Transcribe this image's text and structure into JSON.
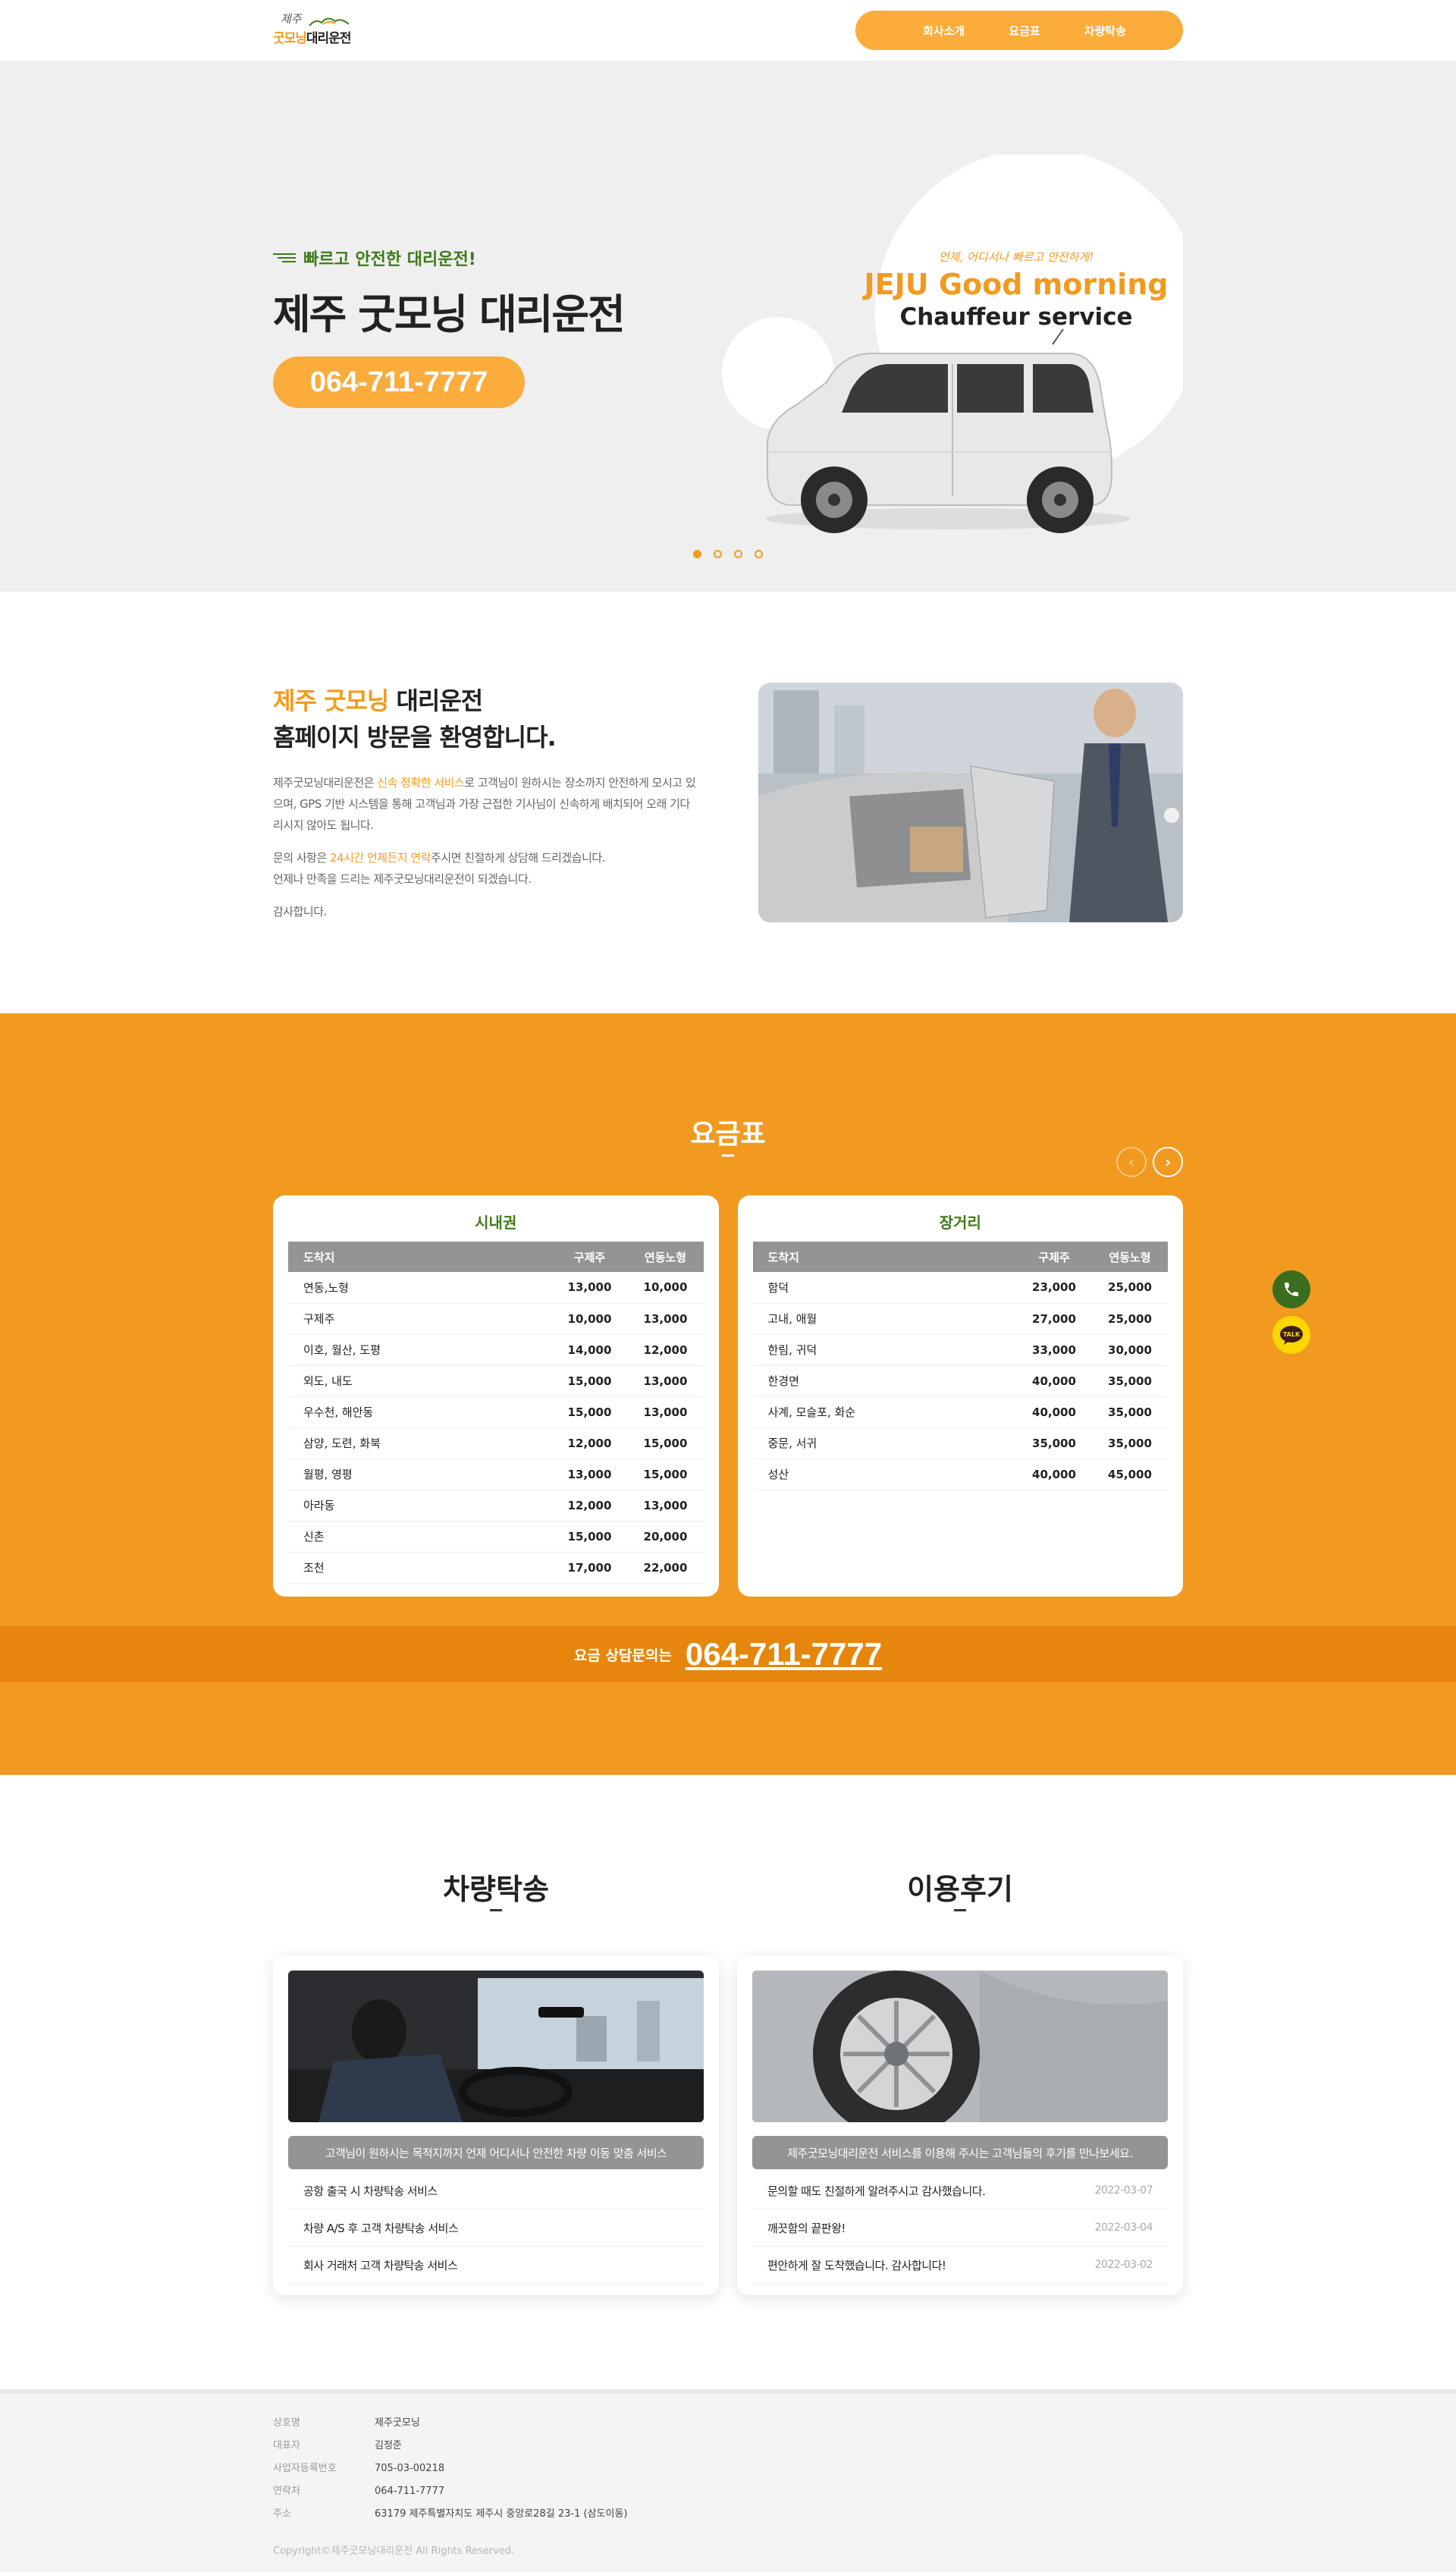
{
  "header": {
    "logo_top": "제주",
    "logo_main_orange": "굿모닝",
    "logo_main_dark": "대리운전",
    "nav": [
      "회사소개",
      "요금표",
      "차량탁송"
    ]
  },
  "hero": {
    "subtitle": "빠르고 안전한 대리운전!",
    "title": "제주 굿모닝 대리운전",
    "phone": "064-711-7777",
    "art_script": "언제, 어디서나 빠르고 안전하게!",
    "art_title": "JEJU Good morning",
    "art_sub": "Chauffeur service",
    "slides": 4
  },
  "welcome": {
    "title_orange": "제주 굿모닝",
    "title_rest": " 대리운전",
    "title_line2": "홈페이지 방문을 환영합니다.",
    "p1_a": "제주굿모닝대리운전은 ",
    "p1_hl": "신속 정확한 서비스",
    "p1_b": "로 고객님이 원하시는 장소까지 안전하게 모시고 있으며, GPS 기반 시스템을 통해 고객님과 가장 근접한 기사님이 신속하게 배치되어 오래 기다리시지 않아도 됩니다.",
    "p2_a": "문의 사항은 ",
    "p2_hl": "24시간 언제든지 연락",
    "p2_b": "주시면 친절하게 상담해 드리겠습니다.",
    "p2_c": "언제나 만족을 드리는 제주굿모닝대리운전이 되겠습니다.",
    "p3": "감사합니다."
  },
  "price": {
    "title": "요금표",
    "prev": "‹",
    "next": "›",
    "tables": [
      {
        "name": "시내권",
        "headers": [
          "도착지",
          "구제주",
          "연동노형"
        ],
        "rows": [
          [
            "연동,노형",
            "13,000",
            "10,000"
          ],
          [
            "구제주",
            "10,000",
            "13,000"
          ],
          [
            "이호, 월산, 도평",
            "14,000",
            "12,000"
          ],
          [
            "외도, 내도",
            "15,000",
            "13,000"
          ],
          [
            "우수천, 해안동",
            "15,000",
            "13,000"
          ],
          [
            "삼양, 도련, 화북",
            "12,000",
            "15,000"
          ],
          [
            "월평, 영평",
            "13,000",
            "15,000"
          ],
          [
            "아라동",
            "12,000",
            "13,000"
          ],
          [
            "신촌",
            "15,000",
            "20,000"
          ],
          [
            "조천",
            "17,000",
            "22,000"
          ]
        ]
      },
      {
        "name": "장거리",
        "headers": [
          "도착지",
          "구제주",
          "연동노형"
        ],
        "rows": [
          [
            "함덕",
            "23,000",
            "25,000"
          ],
          [
            "고내, 애월",
            "27,000",
            "25,000"
          ],
          [
            "한림, 귀덕",
            "33,000",
            "30,000"
          ],
          [
            "한경면",
            "40,000",
            "35,000"
          ],
          [
            "사계, 모슬포, 화순",
            "40,000",
            "35,000"
          ],
          [
            "중문, 서귀",
            "35,000",
            "35,000"
          ],
          [
            "성산",
            "40,000",
            "45,000"
          ]
        ]
      }
    ],
    "bar_label": "요금 상담문의는",
    "bar_phone": "064-711-7777"
  },
  "float": {
    "talk": "TALK"
  },
  "boards": {
    "delivery": {
      "title": "차량탁송",
      "caption": "고객님이 원하시는 목적지까지 언제 어디서나 안전한 차량 이동 맞춤 서비스",
      "items": [
        "공항 출국 시 차량탁송 서비스",
        "차량 A/S 후 고객 차량탁송 서비스",
        "회사 거래처 고객 차량탁송 서비스"
      ]
    },
    "reviews": {
      "title": "이용후기",
      "caption": "제주굿모닝대리운전 서비스를 이용해 주시는 고객님들의 후기를 만나보세요.",
      "items": [
        {
          "text": "문의할 때도 친절하게 알려주시고 감사했습니다.",
          "date": "2022-03-07"
        },
        {
          "text": "깨끗함의 끝판왕!",
          "date": "2022-03-04"
        },
        {
          "text": "편안하게 잘 도착했습니다. 감사합니다!",
          "date": "2022-03-02"
        }
      ]
    }
  },
  "footer": {
    "rows": [
      {
        "k": "상호명",
        "v": "제주굿모닝"
      },
      {
        "k": "대표자",
        "v": "김정준"
      },
      {
        "k": "사업자등록번호",
        "v": "705-03-00218"
      },
      {
        "k": "연락처",
        "v": "064-711-7777"
      },
      {
        "k": "주소",
        "v": "63179 제주특별자치도 제주시 중앙로28길 23-1 (삼도이동)"
      }
    ],
    "copyright": "Copyright©제주굿모닝대리운전 All Rights Reserved."
  },
  "colors": {
    "accent": "#f29a20",
    "green": "#3f7a1b",
    "gray_head": "#949494"
  }
}
